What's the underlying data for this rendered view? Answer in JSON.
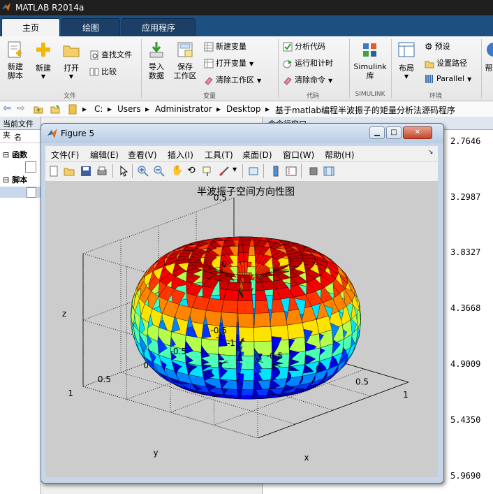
{
  "app": {
    "title": "MATLAB R2014a"
  },
  "tabs": [
    {
      "label": "主页",
      "active": true
    },
    {
      "label": "绘图",
      "active": false
    },
    {
      "label": "应用程序",
      "active": false
    }
  ],
  "ribbon": {
    "file": {
      "new_script": "新建\n脚本",
      "new": "新建",
      "open": "打开",
      "find_files": "查找文件",
      "compare": "比较",
      "group": "文件"
    },
    "variable": {
      "import": "导入\n数据",
      "save_ws": "保存\n工作区",
      "new_var": "新建变量",
      "open_var": "打开变量",
      "clear_ws": "清除工作区",
      "group": "变量"
    },
    "code": {
      "analyze": "分析代码",
      "run_time": "运行和计时",
      "clear_cmd": "清除命令",
      "group": "代码"
    },
    "simulink": {
      "label": "Simulink\n库",
      "group": "SIMULINK"
    },
    "env": {
      "layout": "布局",
      "prefs": "预设",
      "set_path": "设置路径",
      "parallel": "Parallel",
      "group": "环境"
    },
    "help_partial": "帮"
  },
  "address": {
    "segments": [
      "C:",
      "Users",
      "Administrator",
      "Desktop",
      "基于matlab编程半波振子的矩量分析法源码程序"
    ]
  },
  "left_panel": {
    "title": "当前文件夹",
    "column_name": "名",
    "sections": [
      "函数",
      "脚本"
    ]
  },
  "command_window": {
    "title": "命令行窗口",
    "values": [
      "2.7646",
      "3.2987",
      "3.8327",
      "4.3668",
      "4.9009",
      "5.4350",
      "5.9690"
    ]
  },
  "figure": {
    "title": "Figure 5",
    "menus": [
      "文件(F)",
      "编辑(E)",
      "查看(V)",
      "插入(I)",
      "工具(T)",
      "桌面(D)",
      "窗口(W)",
      "帮助(H)"
    ],
    "plot_title": "半波振子空间方向性图",
    "zlabel": "z",
    "xlabel": "x",
    "ylabel": "y"
  },
  "chart_data": {
    "type": "surface",
    "title": "半波振子空间方向性图",
    "xlabel": "x",
    "ylabel": "y",
    "zlabel": "z",
    "xlim": [
      -1,
      1
    ],
    "ylim": [
      -1,
      1
    ],
    "zlim": [
      -0.5,
      0.5
    ],
    "x_ticks": [
      "-1",
      "-0.5",
      "0",
      "0.5",
      "1"
    ],
    "y_ticks": [
      "-1",
      "-0.5",
      "0",
      "0.5",
      "1"
    ],
    "z_ticks": [
      "-0.5",
      "0",
      "0.5"
    ],
    "colormap": "jet",
    "grid": true
  },
  "colors": {
    "titlebar": "#1f1f1f",
    "tabstrip": "#1d4f80",
    "canvas": "#cccccc"
  }
}
